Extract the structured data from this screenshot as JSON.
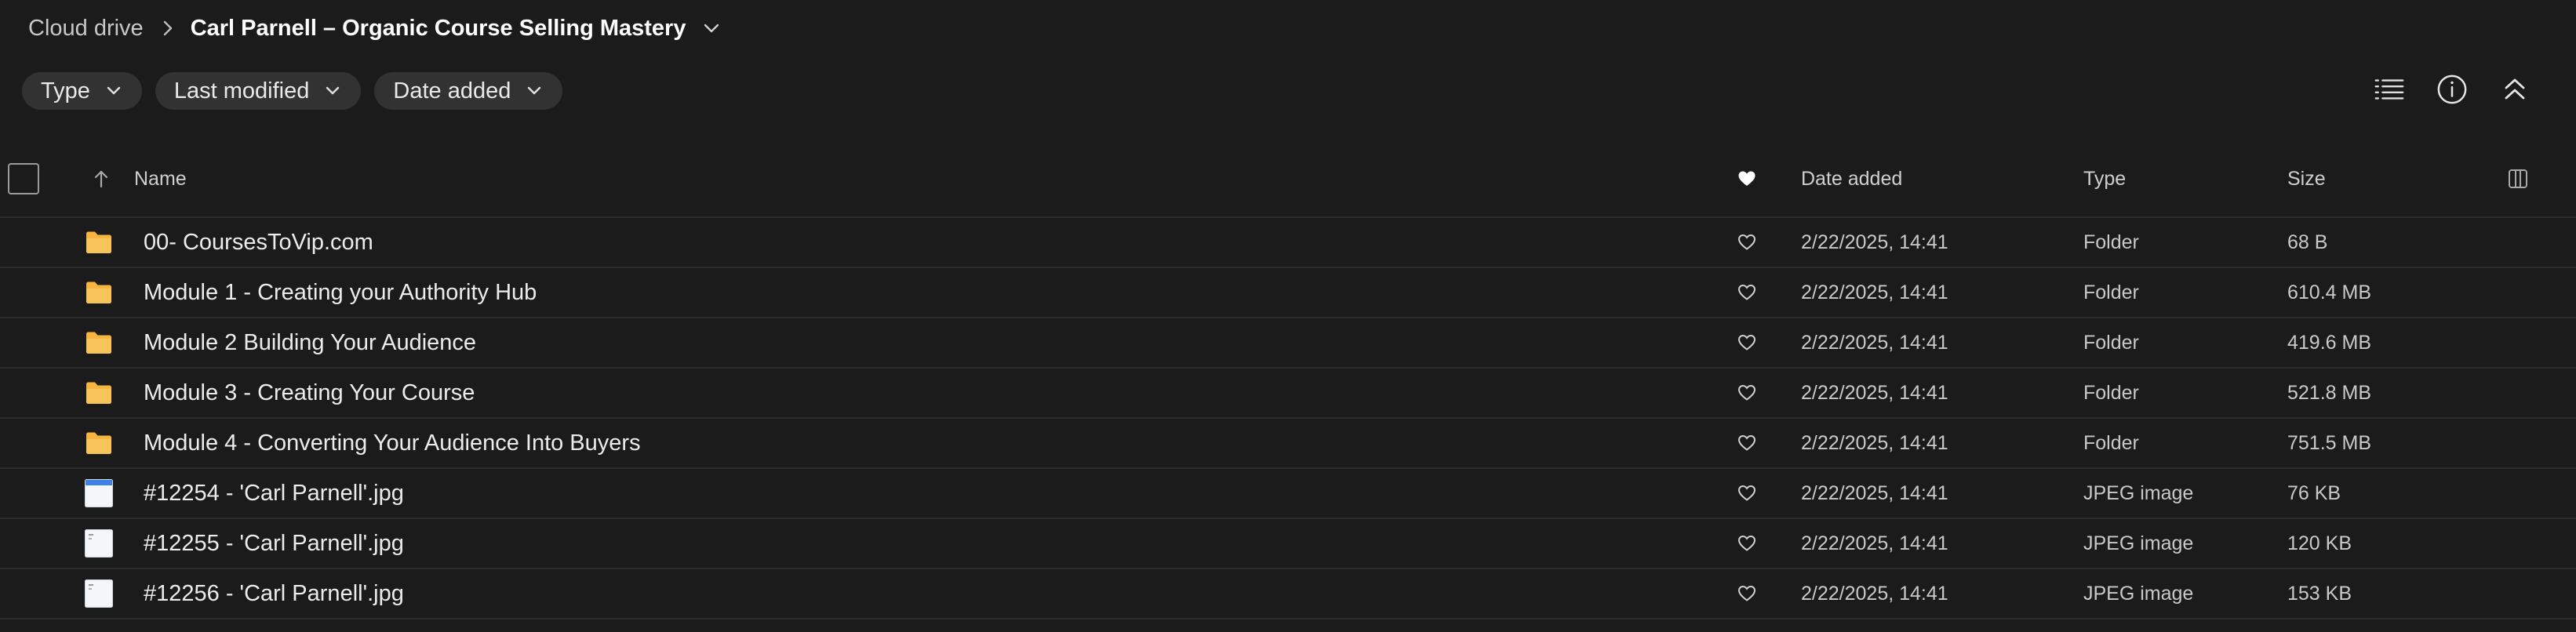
{
  "breadcrumb": {
    "root": "Cloud drive",
    "current": "Carl Parnell – Organic Course Selling Mastery"
  },
  "filters": [
    {
      "label": "Type"
    },
    {
      "label": "Last modified"
    },
    {
      "label": "Date added"
    }
  ],
  "toolbar": {
    "icons": [
      "list-view-icon",
      "info-icon",
      "collapse-icon"
    ]
  },
  "table": {
    "columns": {
      "name": "Name",
      "date_added": "Date added",
      "type": "Type",
      "size": "Size"
    },
    "rows": [
      {
        "name": "00- CoursesToVip.com",
        "date": "2/22/2025, 14:41",
        "type": "Folder",
        "size": "68 B",
        "icon": "folder-icon"
      },
      {
        "name": "Module 1 - Creating your Authority Hub",
        "date": "2/22/2025, 14:41",
        "type": "Folder",
        "size": "610.4 MB",
        "icon": "folder-icon"
      },
      {
        "name": "Module 2 Building Your Audience",
        "date": "2/22/2025, 14:41",
        "type": "Folder",
        "size": "419.6 MB",
        "icon": "folder-icon"
      },
      {
        "name": "Module 3 - Creating Your Course",
        "date": "2/22/2025, 14:41",
        "type": "Folder",
        "size": "521.8 MB",
        "icon": "folder-icon"
      },
      {
        "name": "Module 4 - Converting Your Audience Into Buyers",
        "date": "2/22/2025, 14:41",
        "type": "Folder",
        "size": "751.5 MB",
        "icon": "folder-icon"
      },
      {
        "name": "#12254 - 'Carl Parnell'.jpg",
        "date": "2/22/2025, 14:41",
        "type": "JPEG image",
        "size": "76 KB",
        "icon": "image-thumbnail-icon"
      },
      {
        "name": "#12255 - 'Carl Parnell'.jpg",
        "date": "2/22/2025, 14:41",
        "type": "JPEG image",
        "size": "120 KB",
        "icon": "image-thumbnail-icon"
      },
      {
        "name": "#12256 - 'Carl Parnell'.jpg",
        "date": "2/22/2025, 14:41",
        "type": "JPEG image",
        "size": "153 KB",
        "icon": "image-thumbnail-icon"
      }
    ]
  },
  "colors": {
    "background": "#1b1b1b",
    "chip": "#323232",
    "folder": "#f5b53f",
    "text": "#e6e6e6"
  }
}
